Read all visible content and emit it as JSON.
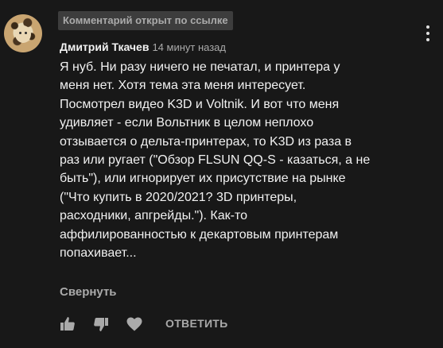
{
  "comment": {
    "pinned_badge": "Комментарий открыт по ссылке",
    "author": "Дмитрий Ткачев",
    "timestamp": "14 минут назад",
    "text_lines": [
      "Я нуб. Ни разу ничего не печатал, и принтера у",
      "меня нет. Хотя тема эта меня интересует.",
      "Посмотрел видео K3D и Voltnik. И вот что меня",
      "удивляет - если Вольтник в целом неплохо",
      "отзывается о дельта-принтерах, то K3D из раза в",
      "раз или ругает (\"Обзор FLSUN QQ-S - казаться, а не",
      "быть\"), или игнорирует их присутствие на рынке",
      "(\"Что купить в 2020/2021? 3D принтеры,",
      "расходники, апгрейды.\"). Как-то",
      "аффилированностью к декартовым принтерам",
      "попахивает..."
    ],
    "collapse_label": "Свернуть",
    "actions": {
      "like_icon": "thumbs-up-icon",
      "dislike_icon": "thumbs-down-icon",
      "heart_icon": "heart-icon",
      "reply_label": "ОТВЕТИТЬ"
    },
    "menu_icon": "vertical-dots-icon"
  },
  "colors": {
    "background": "#181818",
    "text_primary": "#f1f1f1",
    "text_secondary": "#aaaaaa",
    "badge_background": "#3d3d3d"
  }
}
